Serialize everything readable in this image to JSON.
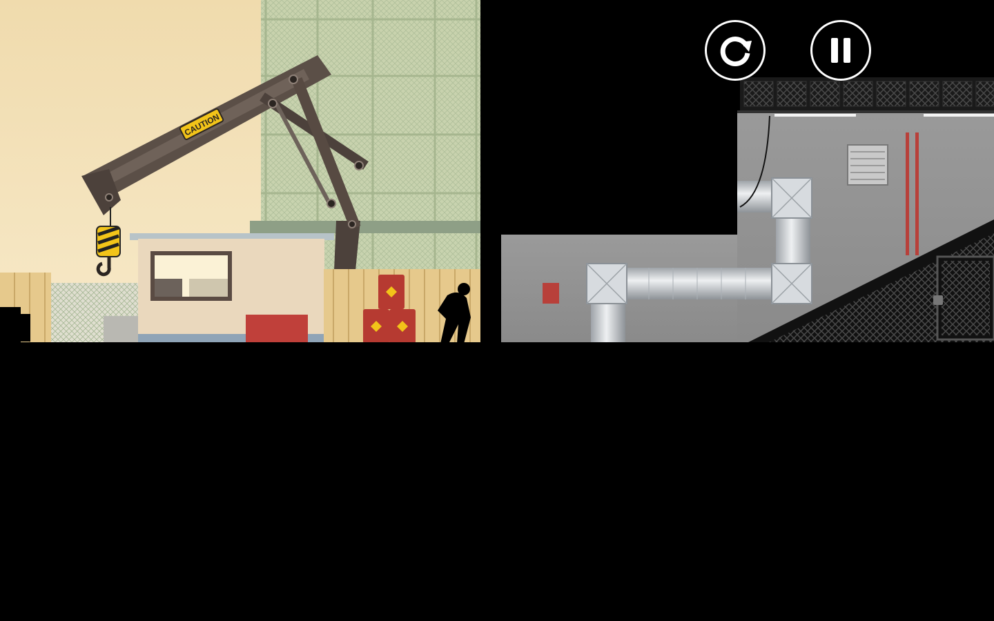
{
  "game": {
    "level_sign": "CAUTION",
    "hud": {
      "restart_icon": "restart-icon",
      "pause_icon": "pause-icon"
    }
  },
  "colors": {
    "sky_top": "#f1ddb0",
    "sky_bottom": "#f6e6c2",
    "scaffold": "#b9c7a3",
    "crane": "#5a4d44",
    "caution_yellow": "#f2c419",
    "fence": "#e3c78b",
    "barrel_red": "#b63a31",
    "interior_wall": "#8f8f8f",
    "pipe": "#d8dcdf",
    "silhouette": "#000000",
    "hud_ring": "#ffffff"
  }
}
